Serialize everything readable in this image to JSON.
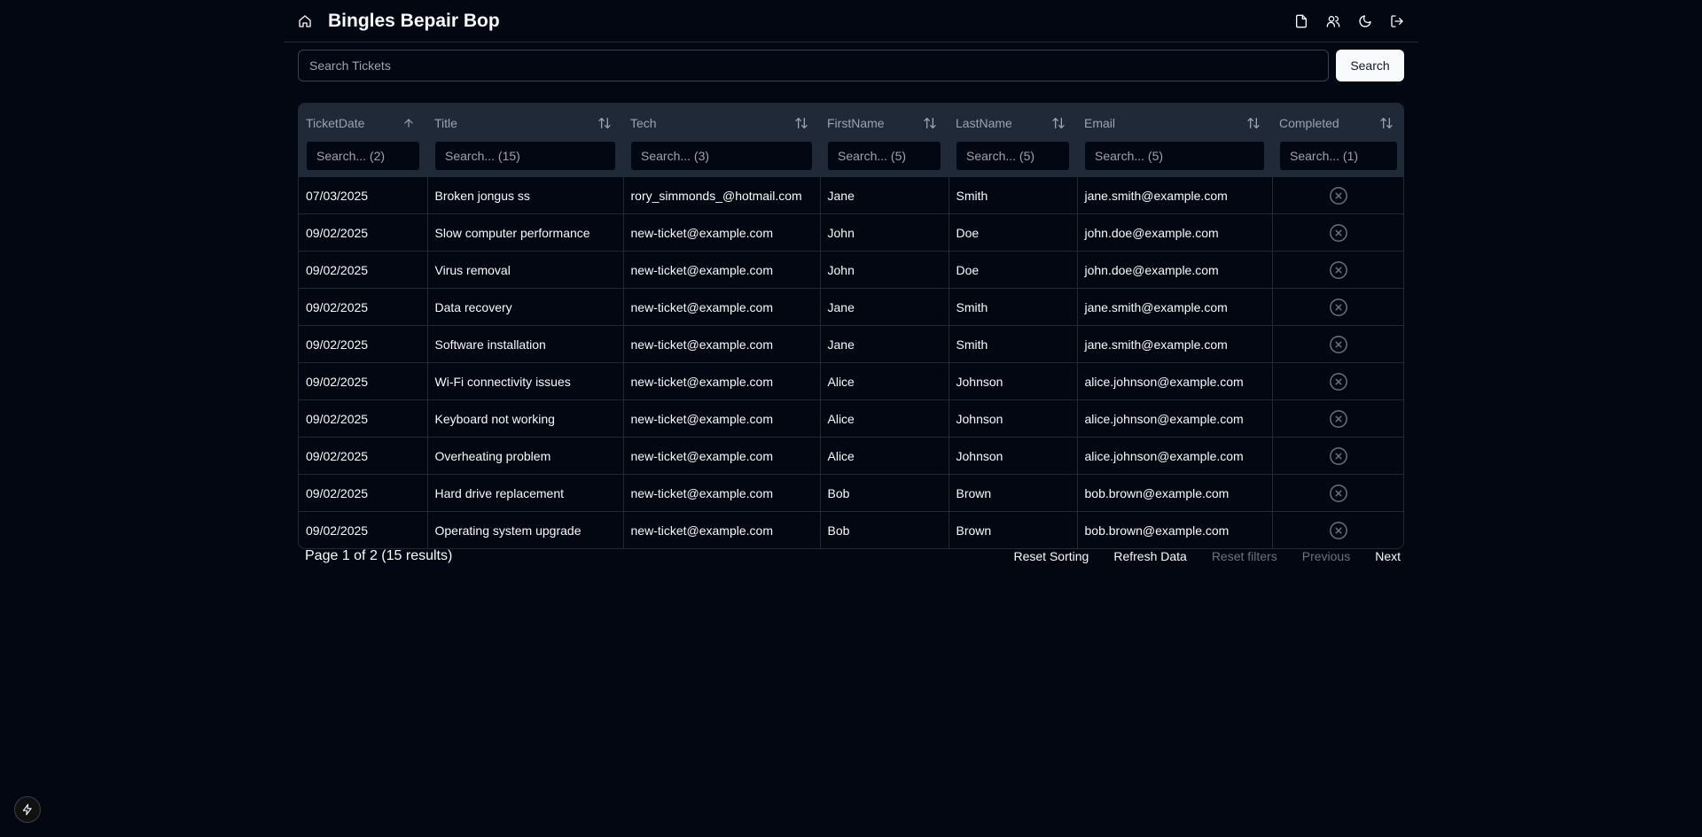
{
  "header": {
    "title": "Bingles Bepair Bop",
    "icons": [
      "home-icon",
      "file-icon",
      "users-icon",
      "moon-icon",
      "logout-icon"
    ]
  },
  "search": {
    "placeholder": "Search Tickets",
    "button_label": "Search"
  },
  "table": {
    "columns": [
      {
        "label": "TicketDate",
        "filter_placeholder": "Search... (2)",
        "sort": "asc"
      },
      {
        "label": "Title",
        "filter_placeholder": "Search... (15)",
        "sort": "none"
      },
      {
        "label": "Tech",
        "filter_placeholder": "Search... (3)",
        "sort": "none"
      },
      {
        "label": "FirstName",
        "filter_placeholder": "Search... (5)",
        "sort": "none"
      },
      {
        "label": "LastName",
        "filter_placeholder": "Search... (5)",
        "sort": "none"
      },
      {
        "label": "Email",
        "filter_placeholder": "Search... (5)",
        "sort": "none"
      },
      {
        "label": "Completed",
        "filter_placeholder": "Search... (1)",
        "sort": "none"
      }
    ],
    "rows": [
      {
        "date": "07/03/2025",
        "title": "Broken jongus ss",
        "tech": "rory_simmonds_@hotmail.com",
        "first": "Jane",
        "last": "Smith",
        "email": "jane.smith@example.com",
        "completed": false
      },
      {
        "date": "09/02/2025",
        "title": "Slow computer performance",
        "tech": "new-ticket@example.com",
        "first": "John",
        "last": "Doe",
        "email": "john.doe@example.com",
        "completed": false
      },
      {
        "date": "09/02/2025",
        "title": "Virus removal",
        "tech": "new-ticket@example.com",
        "first": "John",
        "last": "Doe",
        "email": "john.doe@example.com",
        "completed": false
      },
      {
        "date": "09/02/2025",
        "title": "Data recovery",
        "tech": "new-ticket@example.com",
        "first": "Jane",
        "last": "Smith",
        "email": "jane.smith@example.com",
        "completed": false
      },
      {
        "date": "09/02/2025",
        "title": "Software installation",
        "tech": "new-ticket@example.com",
        "first": "Jane",
        "last": "Smith",
        "email": "jane.smith@example.com",
        "completed": false
      },
      {
        "date": "09/02/2025",
        "title": "Wi-Fi connectivity issues",
        "tech": "new-ticket@example.com",
        "first": "Alice",
        "last": "Johnson",
        "email": "alice.johnson@example.com",
        "completed": false
      },
      {
        "date": "09/02/2025",
        "title": "Keyboard not working",
        "tech": "new-ticket@example.com",
        "first": "Alice",
        "last": "Johnson",
        "email": "alice.johnson@example.com",
        "completed": false
      },
      {
        "date": "09/02/2025",
        "title": "Overheating problem",
        "tech": "new-ticket@example.com",
        "first": "Alice",
        "last": "Johnson",
        "email": "alice.johnson@example.com",
        "completed": false
      },
      {
        "date": "09/02/2025",
        "title": "Hard drive replacement",
        "tech": "new-ticket@example.com",
        "first": "Bob",
        "last": "Brown",
        "email": "bob.brown@example.com",
        "completed": false
      },
      {
        "date": "09/02/2025",
        "title": "Operating system upgrade",
        "tech": "new-ticket@example.com",
        "first": "Bob",
        "last": "Brown",
        "email": "bob.brown@example.com",
        "completed": false
      }
    ]
  },
  "footer": {
    "page_info": "Page 1 of 2 (15 results)",
    "reset_sorting": "Reset Sorting",
    "refresh_data": "Refresh Data",
    "reset_filters": "Reset filters",
    "previous": "Previous",
    "next": "Next"
  },
  "colors": {
    "background": "#030712",
    "header_row": "#1f2937",
    "border": "#1f2937",
    "text": "#f9fafb",
    "muted": "#9ca3af",
    "disabled": "#6b7280"
  }
}
